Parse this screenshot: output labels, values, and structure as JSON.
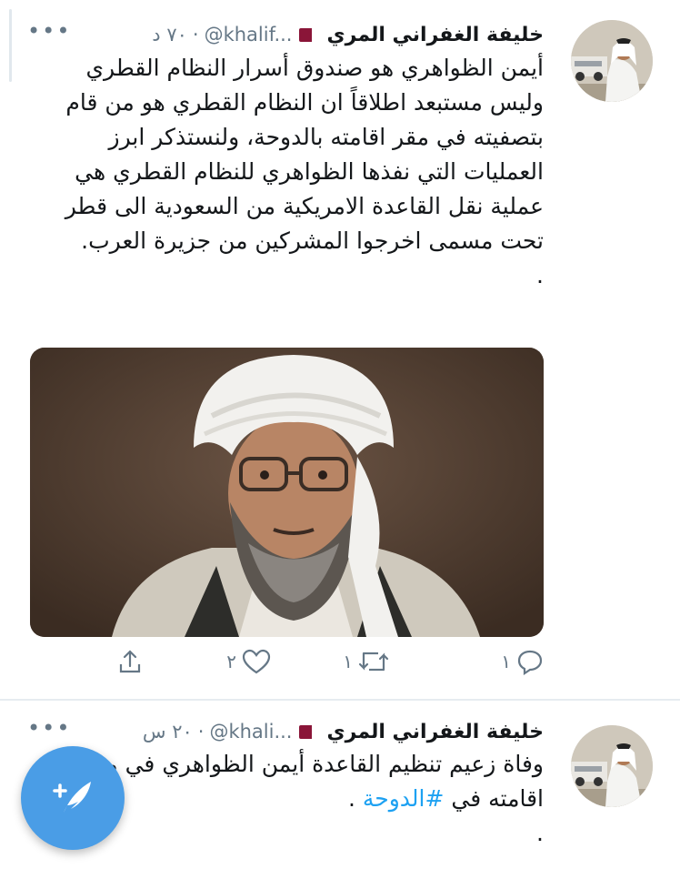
{
  "tweets": [
    {
      "display_name": "خليفة الغفراني المري",
      "handle": "@khalif...",
      "time": "٧٠ د",
      "more": "•••",
      "text": "أيمن الظواهري هو صندوق أسرار النظام القطري وليس مستبعد اطلاقاً ان النظام القطري هو من قام بتصفيته في مقر اقامته بالدوحة، ولنستذكر ابرز العمليات التي نفذها الظواهري للنظام القطري هي عملية نقل القاعدة الامريكية من السعودية الى قطر تحت مسمى اخرجوا المشركين من جزيرة العرب.",
      "text_end": ".",
      "actions": {
        "replies": "١",
        "retweets": "١",
        "likes": "٢"
      }
    },
    {
      "display_name": "خليفة الغفراني المري",
      "handle": "@khali...",
      "time": "٢٠ س",
      "more": "•••",
      "text": "وفاة زعيم تنظيم القاعدة أيمن الظواهري في مقر اقامته في",
      "hashtag": "#الدوحة",
      "text_tail": " .",
      "text_end": "."
    }
  ],
  "icons": {
    "reply": "reply-icon",
    "retweet": "retweet-icon",
    "like": "heart-icon",
    "share": "share-icon",
    "compose": "compose-tweet-icon"
  },
  "colors": {
    "text": "#14171a",
    "muted": "#657786",
    "link": "#1da1f2",
    "fab": "#4a9de6",
    "flag": "#8a1538"
  }
}
